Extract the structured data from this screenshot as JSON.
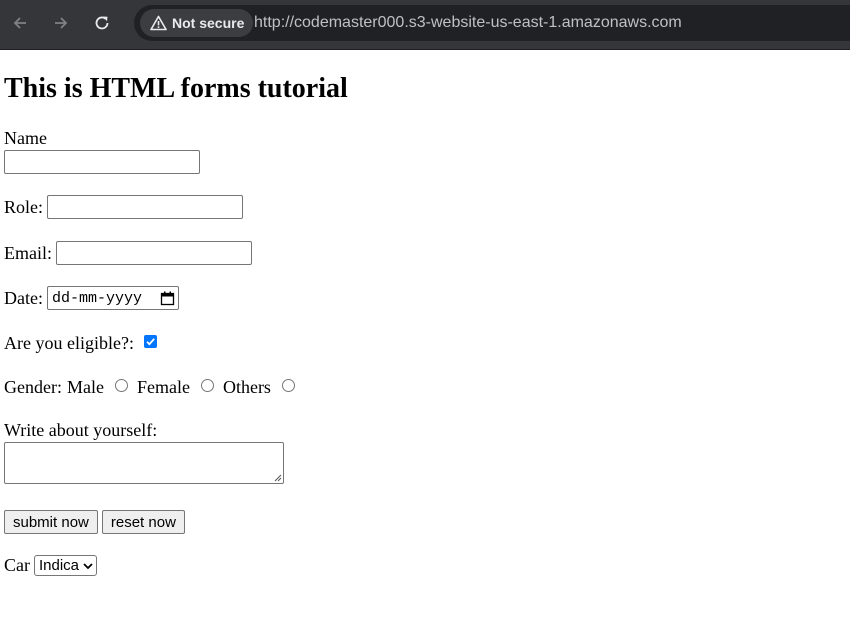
{
  "browser": {
    "security_label": "Not secure",
    "url": "http://codemaster000.s3-website-us-east-1.amazonaws.com",
    "icons": {
      "back": "back-arrow-icon",
      "forward": "forward-arrow-icon",
      "reload": "reload-icon",
      "security": "warning-icon"
    },
    "colors": {
      "chrome": "#35363a",
      "omnibox": "#202124"
    }
  },
  "page": {
    "title": "This is HTML forms tutorial",
    "name_label": "Name",
    "name_value": "",
    "role_label": "Role:",
    "role_value": "",
    "email_label": "Email:",
    "email_value": "",
    "date_label": "Date:",
    "date_placeholder": "dd-mm-yyyy",
    "eligible_label": "Are you eligible?:",
    "eligible_checked": true,
    "gender_label": "Gender:",
    "gender_options": [
      "Male",
      "Female",
      "Others"
    ],
    "about_label": "Write about yourself:",
    "about_value": "",
    "submit_label": "submit now",
    "reset_label": "reset now",
    "car_label": "Car",
    "car_selected": "Indica",
    "accent_color": "#0075ff"
  }
}
